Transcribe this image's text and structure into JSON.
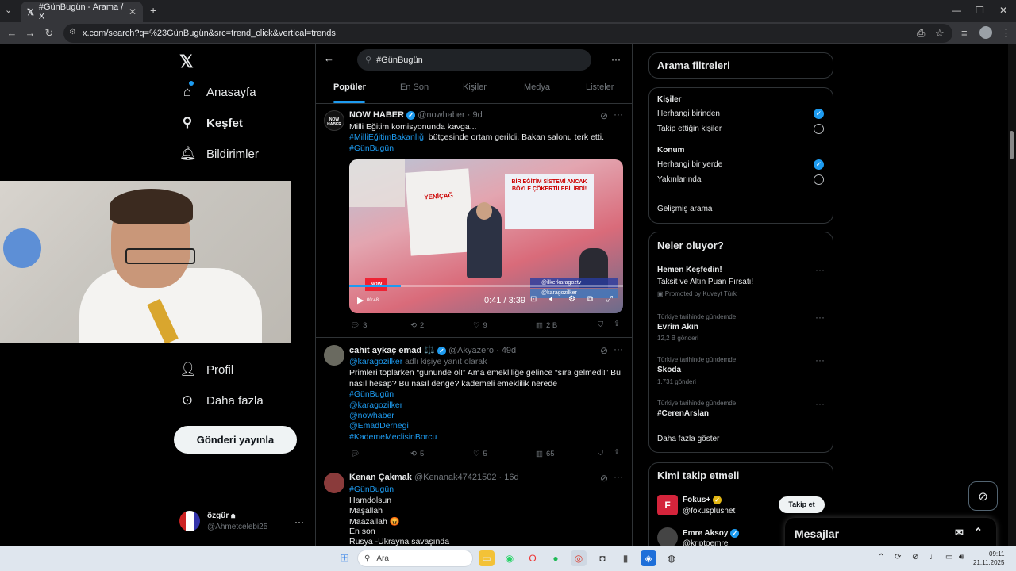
{
  "browser": {
    "tab_title": "#GünBugün - Arama / X",
    "url": "x.com/search?q=%23GünBugün&src=trend_click&vertical=trends"
  },
  "sidebar": {
    "items": [
      {
        "label": "Anasayfa",
        "icon": "home-icon"
      },
      {
        "label": "Keşfet",
        "icon": "search-icon"
      },
      {
        "label": "Bildirimler",
        "icon": "bell-icon"
      },
      {
        "label": "Profil",
        "icon": "person-icon"
      },
      {
        "label": "Daha fazla",
        "icon": "more-circle-icon"
      }
    ],
    "post_button": "Gönderi yayınla",
    "account": {
      "name": "özgür",
      "handle": "@Ahmetcelebi25"
    }
  },
  "search": {
    "query": "#GünBugün"
  },
  "tabs": [
    "Popüler",
    "En Son",
    "Kişiler",
    "Medya",
    "Listeler"
  ],
  "tweets": [
    {
      "name": "NOW HABER",
      "handle": "@nowhaber",
      "time": "· 9d",
      "avatar_text": "NOW HABER",
      "line1": "Milli Eğitim komisyonunda kavga...",
      "line2_tag": "#MilliEğitimBakanlığı",
      "line2_text": " bütçesinde ortam gerildi, Bakan salonu terk etti.",
      "line3_tag": "#GünBugün",
      "video": {
        "time": "0:41 / 3:39",
        "headline_left": "YENİÇAĞ",
        "headline_right": "BİR EĞİTİM SİSTEMİ ANCAK BÖYLE ÇÖKERTİLEBİLİRDİ!",
        "overlay1": "@ilkerkaragoztv",
        "overlay2": "@karagozilker",
        "live_badge": "NOW",
        "live_time": "00:48"
      },
      "replies": "3",
      "reposts": "2",
      "likes": "9",
      "views": "2 B"
    },
    {
      "name": "cahit aykaç emad ⚖️",
      "handle": "@Akyazero",
      "time": "· 49d",
      "reply_to": "@karagozilker",
      "reply_suffix": " adlı kişiye yanıt olarak",
      "line1": "Primleri toplarken “gününde ol!” Ama emekliliğe gelince “sıra gelmedi!” Bu",
      "line2": "nasıl hesap? Bu nasıl denge? kademeli emeklilik nerede",
      "tags": [
        "#GünBugün",
        "@karagozilker",
        "@nowhaber",
        "@EmadDernegi",
        "#KademeMeclisinBorcu"
      ],
      "replies": "",
      "reposts": "5",
      "likes": "5",
      "views": "65"
    },
    {
      "name": "Kenan Çakmak",
      "handle": "@Kenanak47421502",
      "time": "· 16d",
      "lines": [
        "#GünBugün",
        "Hamdolsun",
        "Maşallah",
        "Maazallah 😡",
        "En son",
        "Rusya -Ukrayna savaşında"
      ]
    }
  ],
  "filters": {
    "title": "Arama filtreleri",
    "people_label": "Kişiler",
    "people_opt1": "Herhangi birinden",
    "people_opt2": "Takip ettiğin kişiler",
    "location_label": "Konum",
    "loc_opt1": "Herhangi bir yerde",
    "loc_opt2": "Yakınlarında",
    "advanced": "Gelişmiş arama"
  },
  "trends": {
    "title": "Neler oluyor?",
    "promo_title": "Hemen Keşfedin!",
    "promo_sub": "Taksit ve Altın Puan Fırsatı!",
    "promo_by": "Promoted by Kuveyt Türk",
    "items": [
      {
        "context": "Türkiye tarihinde gündemde",
        "name": "Evrim Akın",
        "count": "12,2 B gönderi"
      },
      {
        "context": "Türkiye tarihinde gündemde",
        "name": "Skoda",
        "count": "1.731 gönderi"
      },
      {
        "context": "Türkiye tarihinde gündemde",
        "name": "#CerenArslan",
        "count": ""
      }
    ],
    "show_more": "Daha fazla göster"
  },
  "who_to_follow": {
    "title": "Kimi takip etmeli",
    "users": [
      {
        "name": "Fokus+",
        "handle": "@fokusplusnet",
        "button": "Takip et"
      },
      {
        "name": "Emre Aksoy",
        "handle": "@kriptoemre",
        "button": "Takip et"
      }
    ]
  },
  "messages": {
    "title": "Mesajlar"
  },
  "taskbar": {
    "search_placeholder": "Ara",
    "time": "09:11",
    "date": "21.11.2025"
  }
}
